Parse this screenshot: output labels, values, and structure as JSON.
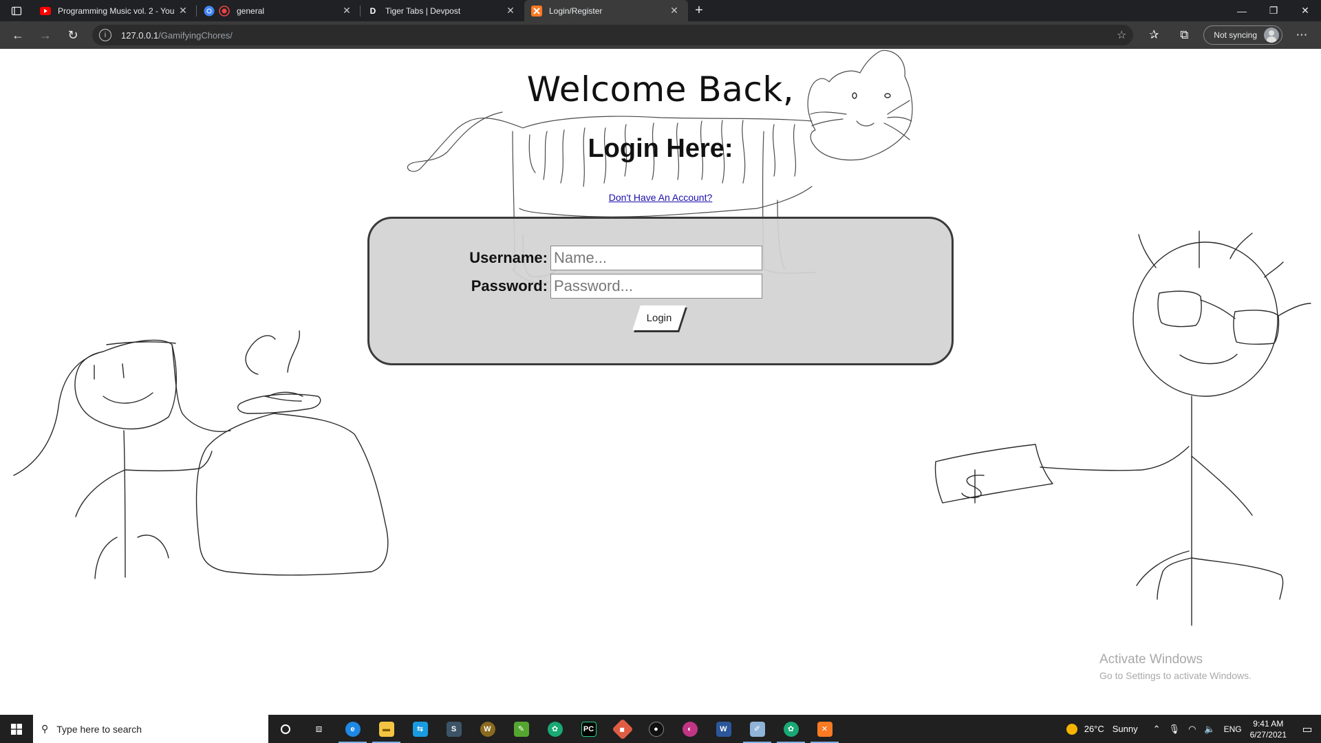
{
  "browser": {
    "tabs": [
      {
        "title": "Programming Music vol. 2 - You",
        "favicon": "youtube-icon",
        "color": "#ff0000"
      },
      {
        "title": "general",
        "favicon": "discord-icon",
        "color": "#ed4245"
      },
      {
        "title": "Tiger Tabs | Devpost",
        "favicon": "devpost-icon",
        "color": "#1e3a5f",
        "letter": "D"
      },
      {
        "title": "Login/Register",
        "favicon": "xampp-icon",
        "color": "#fb7a24"
      }
    ],
    "url": {
      "host": "127.0.0.1",
      "path": "/GamifyingChores/"
    },
    "sync_label": "Not syncing"
  },
  "page": {
    "welcome": "Welcome Back,",
    "heading": "Login Here:",
    "register_link": "Don't Have An Account?",
    "form": {
      "username_label": "Username:",
      "username_placeholder": "Name...",
      "password_label": "Password:",
      "password_placeholder": "Password...",
      "login_button": "Login"
    }
  },
  "watermark": {
    "line1": "Activate Windows",
    "line2": "Go to Settings to activate Windows."
  },
  "taskbar": {
    "search_placeholder": "Type here to search",
    "weather": {
      "temp": "26°C",
      "condition": "Sunny"
    },
    "language": "ENG",
    "time": "9:41 AM",
    "date": "6/27/2021"
  }
}
